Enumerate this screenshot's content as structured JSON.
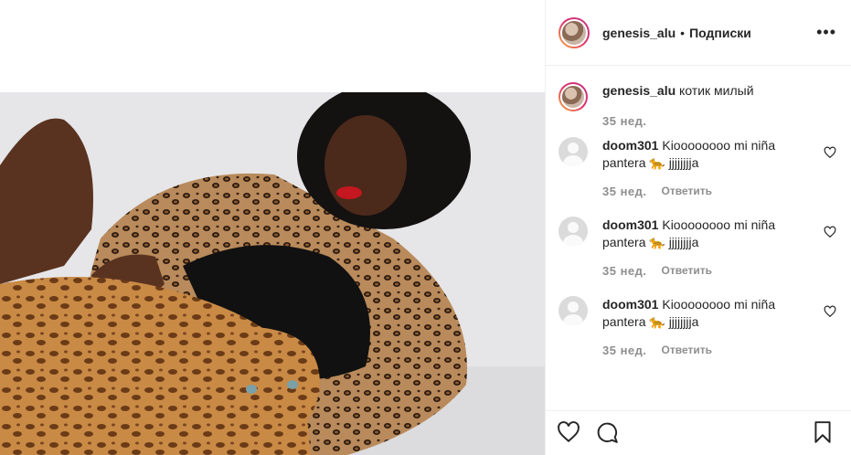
{
  "post": {
    "author": "genesis_alu",
    "separator": "•",
    "follow_label": "Подписки",
    "more_icon": "more-icon",
    "caption": {
      "author": "genesis_alu",
      "text": "котик милый",
      "time": "35 нед."
    },
    "comments": [
      {
        "author": "doom301",
        "text": "Kioooooooo mi niña pantera 🐆 jjjjjjjja",
        "time": "35 нед.",
        "reply_label": "Ответить"
      },
      {
        "author": "doom301",
        "text": "Kioooooooo mi niña pantera 🐆 jjjjjjjja",
        "time": "35 нед.",
        "reply_label": "Ответить"
      },
      {
        "author": "doom301",
        "text": "Kioooooooo mi niña pantera 🐆 jjjjjjjja",
        "time": "35 нед.",
        "reply_label": "Ответить"
      }
    ],
    "actions": {
      "like_icon": "heart-icon",
      "comment_icon": "comment-icon",
      "save_icon": "bookmark-icon"
    }
  },
  "colors": {
    "text": "#262626",
    "muted": "#8e8e8e",
    "border": "#efefef",
    "ring_start": "#f9b13a",
    "ring_end": "#c13584"
  }
}
